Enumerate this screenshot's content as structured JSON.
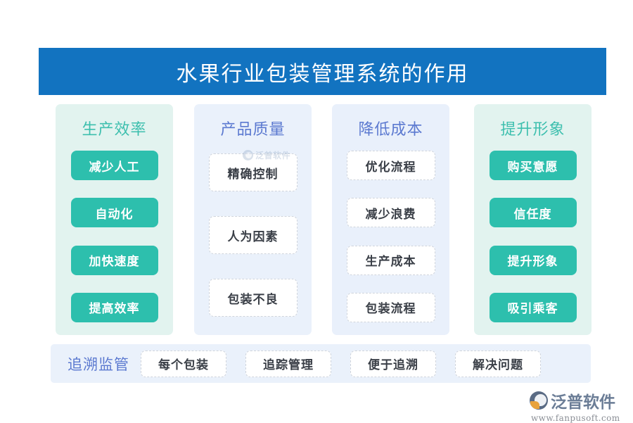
{
  "title": {
    "text": "水果行业包装管理系统的作用",
    "banner_color": "#1273C0",
    "text_color": "#FFFFFF"
  },
  "columns": [
    {
      "header": "生产效率",
      "header_color": "#3DBFAE",
      "panel_color": "#E2F3EF",
      "style": "pill",
      "items": [
        "减少人工",
        "自动化",
        "加快速度",
        "提高效率"
      ]
    },
    {
      "header": "产品质量",
      "header_color": "#5B79D0",
      "panel_color": "#EAF1FB",
      "style": "card",
      "items": [
        "精确控制",
        "人为因素",
        "包装不良"
      ]
    },
    {
      "header": "降低成本",
      "header_color": "#5B79D0",
      "panel_color": "#E9F0FB",
      "style": "card",
      "items": [
        "优化流程",
        "减少浪费",
        "生产成本",
        "包装流程"
      ]
    },
    {
      "header": "提升形象",
      "header_color": "#3DBFAE",
      "panel_color": "#E2F3EF",
      "style": "pill",
      "items": [
        "购买意愿",
        "信任度",
        "提升形象",
        "吸引乘客"
      ]
    }
  ],
  "bottom_bar": {
    "label": "追溯监管",
    "label_color": "#5B79D0",
    "bar_color": "#EAF1FB",
    "items": [
      "每个包装",
      "追踪管理",
      "便于追溯",
      "解决问题"
    ]
  },
  "watermark": {
    "text": "泛普软件"
  },
  "logo": {
    "name": "泛普软件",
    "url": "www.fanpusoft.com"
  },
  "accent_colors": {
    "teal_pill": "#2DBFAD",
    "banner_blue": "#1273C0",
    "card_border": "#CFD4DC",
    "card_text": "#3A3F47"
  }
}
